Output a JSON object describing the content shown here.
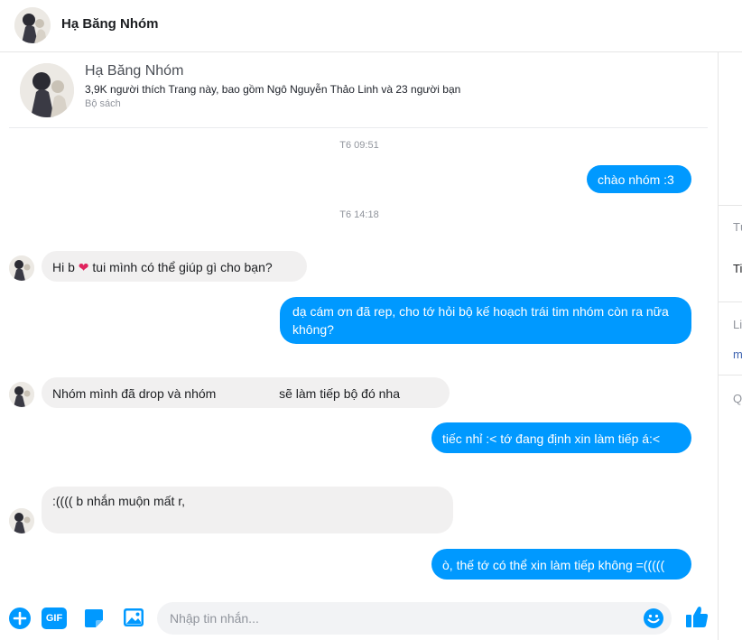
{
  "header": {
    "title": "Hạ Băng Nhóm"
  },
  "page_info": {
    "name": "Hạ Băng Nhóm",
    "likes": "3,9K người thích Trang này, bao gồm Ngô Nguyễn Thảo Linh và 23 người bạn",
    "category": "Bộ sách"
  },
  "messages": [
    {
      "kind": "timestamp",
      "text": "T6 09:51"
    },
    {
      "kind": "out",
      "text": "chào nhóm :3"
    },
    {
      "kind": "timestamp",
      "text": "T6 14:18"
    },
    {
      "kind": "in",
      "text_before": "Hi b",
      "emoji": "❤",
      "text_after": "tui mình có thể giúp gì cho bạn?"
    },
    {
      "kind": "out",
      "text": "dạ cám ơn đã rep, cho tớ hỏi bộ kế hoạch trái tim nhóm còn ra nữa không?"
    },
    {
      "kind": "in",
      "text_before": "Nhóm mình đã drop và nhóm",
      "text_after": "sẽ làm tiếp bộ đó nha"
    },
    {
      "kind": "out",
      "text": "tiếc nhỉ :< tớ đang định xin làm tiếp á:<"
    },
    {
      "kind": "in",
      "text": ":(((( b nhắn muộn mất r,"
    },
    {
      "kind": "out",
      "text": "ò, thế tớ có thể xin làm tiếp không =((((("
    }
  ],
  "composer": {
    "placeholder": "Nhập tin nhắn...",
    "gif_label": "GIF"
  },
  "right_panel": {
    "labels": [
      "Tù",
      "Ti",
      "Li",
      "m",
      "Q"
    ]
  },
  "colors": {
    "accent": "#0099ff",
    "incoming_bubble": "#f1f0f0"
  }
}
